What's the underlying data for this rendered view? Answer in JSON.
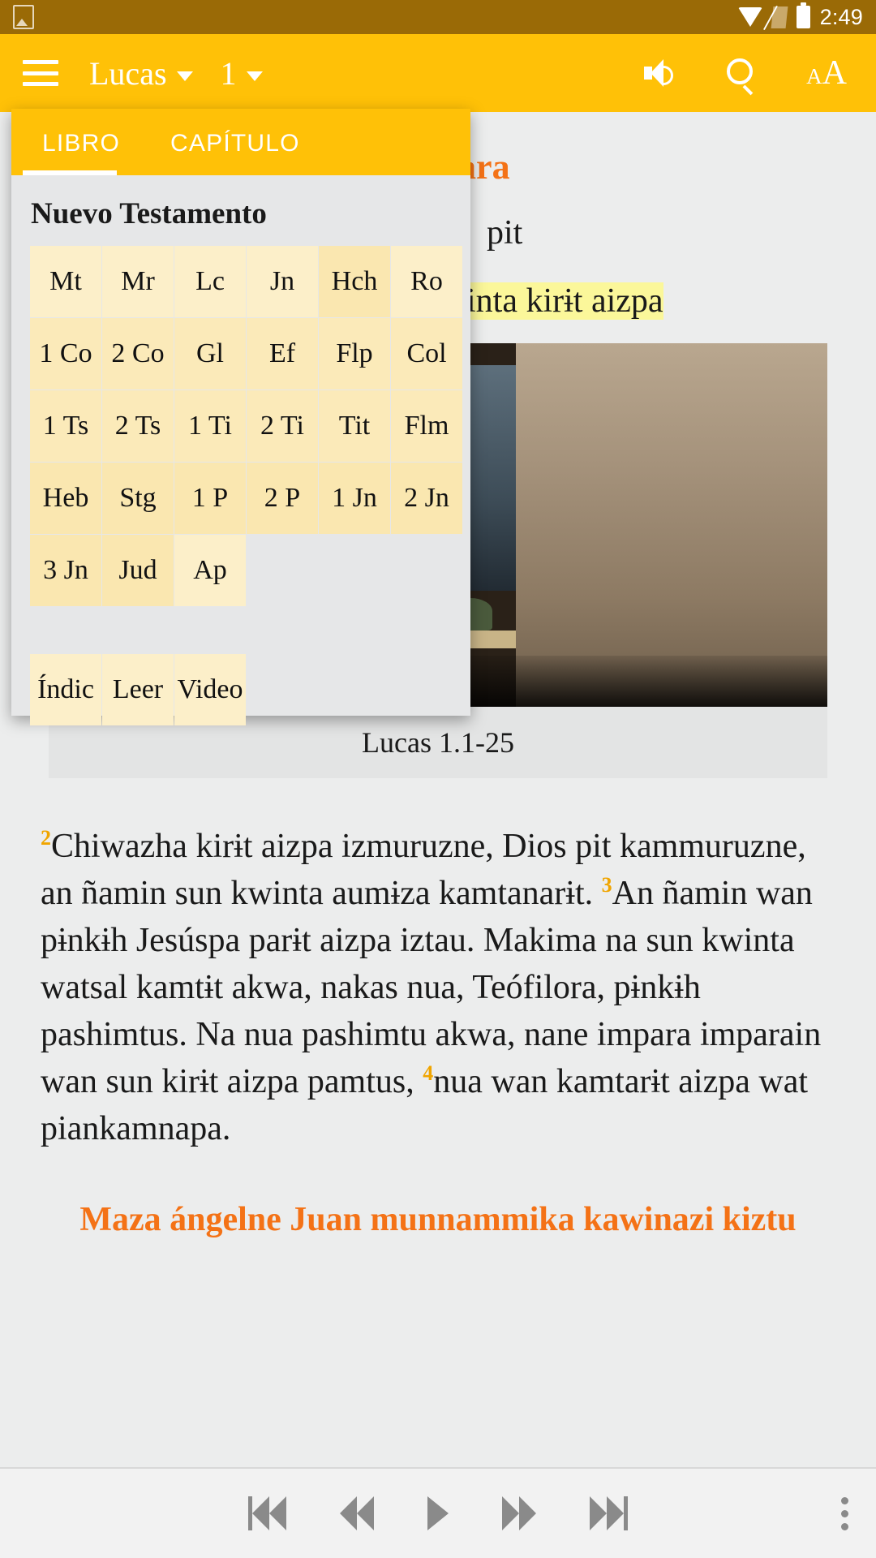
{
  "status_bar": {
    "time": "2:49",
    "icons": [
      "gallery-icon",
      "wifi-icon",
      "sim-card-icon",
      "battery-icon"
    ]
  },
  "app_bar": {
    "menu_icon": "hamburger-menu-icon",
    "book_label": "Lucas",
    "chapter_label": "1",
    "actions": [
      {
        "name": "audio-icon",
        "label": "Audio"
      },
      {
        "name": "search-icon",
        "label": "Buscar"
      },
      {
        "name": "text-size-icon",
        "label": "Tamaño de texto"
      }
    ]
  },
  "book_panel": {
    "tabs": [
      {
        "label": "LIBRO",
        "selected": true
      },
      {
        "label": "CAPÍTULO",
        "selected": false
      }
    ],
    "section_title": "Nuevo Testamento",
    "books": [
      "Mt",
      "Mr",
      "Lc",
      "Jn",
      "Hch",
      "Ro",
      "1 Co",
      "2 Co",
      "Gl",
      "Ef",
      "Flp",
      "Col",
      "1 Ts",
      "2 Ts",
      "1 Ti",
      "2 Ti",
      "Tit",
      "Flm",
      "Heb",
      "Stg",
      "1 P",
      "2 P",
      "1 Jn",
      "2 Jn",
      "3 Jn",
      "Jud",
      "Ap"
    ],
    "actions": [
      "Índic",
      "Leer",
      "Video"
    ]
  },
  "reader": {
    "heading_1": "owa Para",
    "verse_lead_a": "pit",
    "verse_lead_b": "inta kirɨt aizpa",
    "figure_caption": "Lucas 1.1-25",
    "paragraph": {
      "v2_num": "2",
      "v2_text": "Chiwazha kirɨt aizpa izmuruzne, Dios pit kammuruzne, an ñamin sun kwinta aumɨza kamtanarɨt. ",
      "v3_num": "3",
      "v3_text": "An ñamin wan pɨnkɨh Jesúspa parɨt aizpa iztau. Makima na sun kwinta watsal kamtɨt akwa, nakas nua, Teófilora, pɨnkɨh pashimtus. Na nua pashimtu akwa, nane impara imparain wan sun kirɨt aizpa pamtus, ",
      "v4_num": "4",
      "v4_text": "nua wan kamtarɨt aizpa wat piankamnapa."
    },
    "heading_2": "Maza ángelne Juan munnammika kawinazi kiztu"
  },
  "player": {
    "controls": [
      {
        "name": "skip-previous-button",
        "label": "Anterior"
      },
      {
        "name": "rewind-button",
        "label": "Retroceder"
      },
      {
        "name": "play-button",
        "label": "Reproducir"
      },
      {
        "name": "fast-forward-button",
        "label": "Avanzar"
      },
      {
        "name": "skip-next-button",
        "label": "Siguiente"
      }
    ],
    "overflow": "more-options-icon"
  },
  "colors": {
    "accent": "#ffc107",
    "status_bar": "#9a6a06",
    "heading": "#f47216",
    "highlight": "#fbf79a",
    "verse_number": "#f0a500",
    "page_bg": "#eceded"
  }
}
